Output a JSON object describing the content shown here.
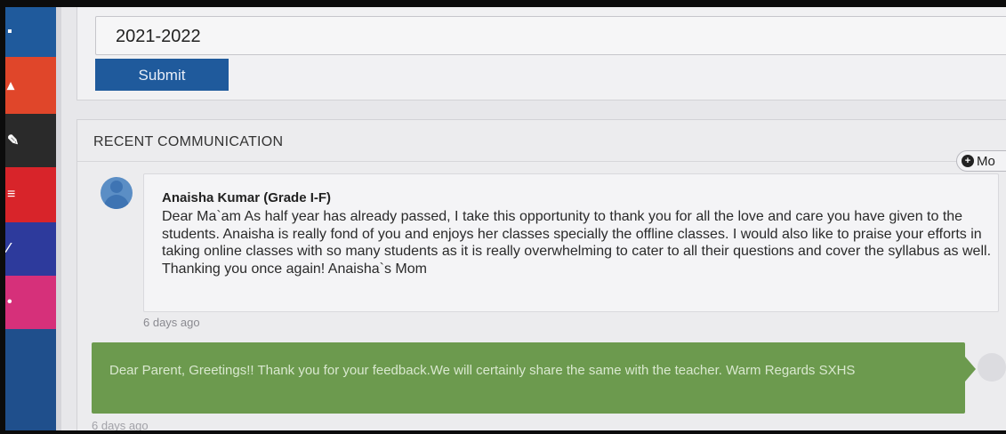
{
  "form": {
    "year_value": "2021-2022",
    "submit_label": "Submit"
  },
  "sidebar": {
    "items": [
      {
        "icon": "user-icon",
        "color": "#1f5a9c"
      },
      {
        "icon": "person-icon",
        "color": "#e0462a"
      },
      {
        "icon": "edit-icon",
        "color": "#2a2a2a"
      },
      {
        "icon": "list-icon",
        "color": "#d8242a"
      },
      {
        "icon": "pin-icon",
        "color": "#2d3a9c"
      },
      {
        "icon": "dot-icon",
        "color": "#d6307a"
      },
      {
        "icon": "blank",
        "color": "#1f4f8c"
      }
    ]
  },
  "communication": {
    "title": "RECENT COMMUNICATION",
    "more_label": "Mo",
    "message": {
      "sender": "Anaisha Kumar (Grade I-F)",
      "body": "Dear Ma`am As half year has already passed, I take this opportunity to thank you for all the love and care you have given to the students. Anaisha is really fond of you and enjoys her classes specially the offline classes. I would also like to praise your efforts in taking online classes with so many students as it is really overwhelming to cater to all their questions and cover the syllabus as well. Thanking you once again! Anaisha`s Mom",
      "time": "6 days ago"
    },
    "reply": {
      "body": "Dear Parent, Greetings!! Thank you for your feedback.We will certainly share the same with the teacher. Warm Regards SXHS",
      "time": "6 days ago",
      "color": "#6c9a4e"
    }
  }
}
